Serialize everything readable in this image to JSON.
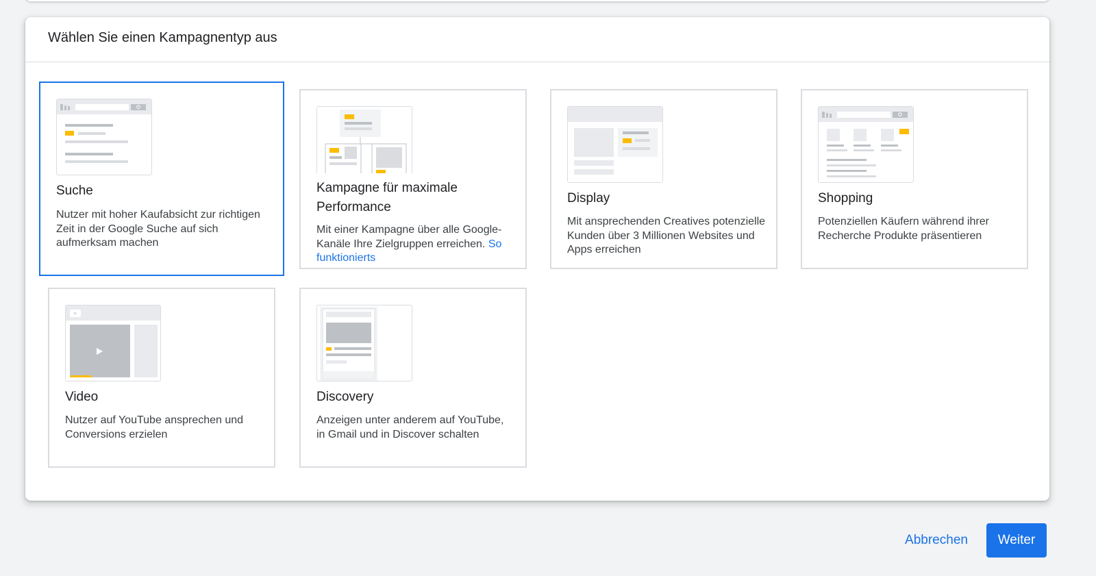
{
  "dialog": {
    "title": "Wählen Sie einen Kampagnentyp aus"
  },
  "cards": [
    {
      "title": "Suche",
      "description": "Nutzer mit hoher Kaufabsicht zur richtigen Zeit in der Google Suche auf sich aufmerksam machen",
      "selected": true,
      "icon": "search-campaign-illustration"
    },
    {
      "title": "Kampagne für maximale Performance",
      "description": "Mit einer Kampagne über alle Google-Kanäle Ihre Zielgruppen erreichen.",
      "link": "So funktionierts",
      "selected": false,
      "icon": "performance-max-illustration"
    },
    {
      "title": "Display",
      "description": "Mit ansprechenden Creatives potenzielle Kunden über 3 Millionen Websites und Apps erreichen",
      "selected": false,
      "icon": "display-campaign-illustration"
    },
    {
      "title": "Shopping",
      "description": "Potenziellen Käufern während ihrer Recherche Produkte präsentieren",
      "selected": false,
      "icon": "shopping-campaign-illustration"
    },
    {
      "title": "Video",
      "description": "Nutzer auf YouTube ansprechen und Conversions erzielen",
      "selected": false,
      "icon": "video-campaign-illustration"
    },
    {
      "title": "Discovery",
      "description": "Anzeigen unter anderem auf YouTube, in Gmail und in Discover schalten",
      "selected": false,
      "icon": "discovery-campaign-illustration"
    }
  ],
  "footer": {
    "cancel_label": "Abbrechen",
    "next_label": "Weiter"
  },
  "colors": {
    "accent": "#1a73e8",
    "illustration_highlight": "#fbbc04",
    "illustration_gray": "#dadce0",
    "border": "#dadce0"
  }
}
